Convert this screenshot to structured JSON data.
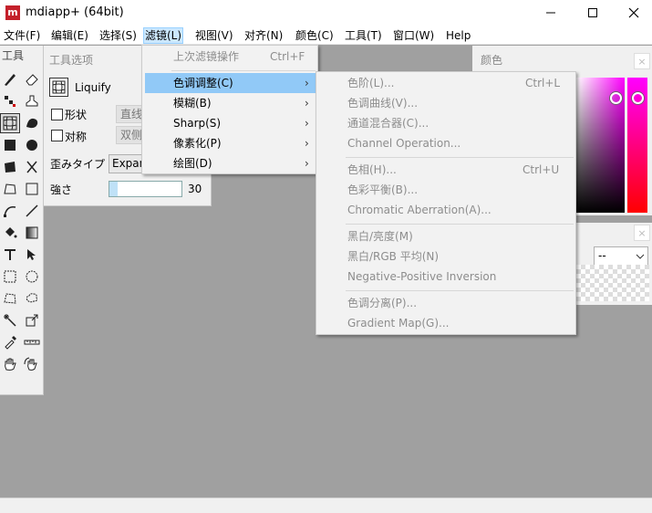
{
  "titlebar": {
    "logo": "m",
    "title": "mdiapp+ (64bit)",
    "minimize_icon": "minimize-icon",
    "maximize_icon": "maximize-icon",
    "close_icon": "close-icon"
  },
  "menubar": {
    "items": [
      "文件(F)",
      "编辑(E)",
      "选择(S)",
      "滤镜(L)",
      "视图(V)",
      "对齐(N)",
      "颜色(C)",
      "工具(T)",
      "窗口(W)",
      "Help"
    ],
    "active": "滤镜(L)"
  },
  "tool_panel": {
    "title": "工具",
    "tools": [
      "pen-icon",
      "eraser-icon",
      "dot-pattern-icon",
      "stamp-icon",
      "liquify-icon",
      "blend-icon",
      "square-fill-icon",
      "circle-fill-icon",
      "shape-fill-icon",
      "cut-icon",
      "polygon-icon",
      "rectangle-icon",
      "bezier-icon",
      "line-icon",
      "bucket-icon",
      "gradient-icon",
      "text-icon",
      "move-icon",
      "rect-select-icon",
      "ellipse-select-icon",
      "lasso-icon",
      "cloud-lasso-icon",
      "magic-wand-icon",
      "transform-icon",
      "eyedropper-icon",
      "ruler-icon",
      "hand-icon",
      "rotate-hand-icon"
    ]
  },
  "tool_options": {
    "title": "工具选项",
    "tool_name": "Liquify",
    "shape_label": "形状",
    "shape_value": "直线",
    "symmetry_label": "对称",
    "symmetry_value": "双侧",
    "distort_label": "歪みタイプ",
    "distort_value": "Expans",
    "strength_label": "強さ",
    "strength_value": "30",
    "strength_fraction": 0.12
  },
  "color_panel": {
    "title": "颜色",
    "close": "×",
    "hue_color": "#ff00ff"
  },
  "layer_panel": {
    "close": "×",
    "combo_value": "--"
  },
  "filter_menu": {
    "items": [
      {
        "label": "上次滤镜操作",
        "shortcut": "Ctrl+F",
        "disabled": true
      },
      {
        "label": "色调调整(C)",
        "submenu": true,
        "hover": true
      },
      {
        "label": "模糊(B)",
        "submenu": true
      },
      {
        "label": "Sharp(S)",
        "submenu": true
      },
      {
        "label": "像素化(P)",
        "submenu": true
      },
      {
        "label": "绘图(D)",
        "submenu": true
      }
    ]
  },
  "color_adjust_submenu": {
    "items": [
      {
        "label": "色阶(L)...",
        "shortcut": "Ctrl+L"
      },
      {
        "label": "色调曲线(V)..."
      },
      {
        "label": "通道混合器(C)..."
      },
      {
        "label": "Channel Operation..."
      },
      {
        "label": "色相(H)...",
        "shortcut": "Ctrl+U"
      },
      {
        "label": "色彩平衡(B)..."
      },
      {
        "label": "Chromatic Aberration(A)..."
      },
      {
        "label": "黑白/亮度(M)"
      },
      {
        "label": "黑白/RGB 平均(N)"
      },
      {
        "label": "Negative-Positive Inversion"
      },
      {
        "label": "色调分离(P)..."
      },
      {
        "label": "Gradient Map(G)..."
      }
    ]
  }
}
